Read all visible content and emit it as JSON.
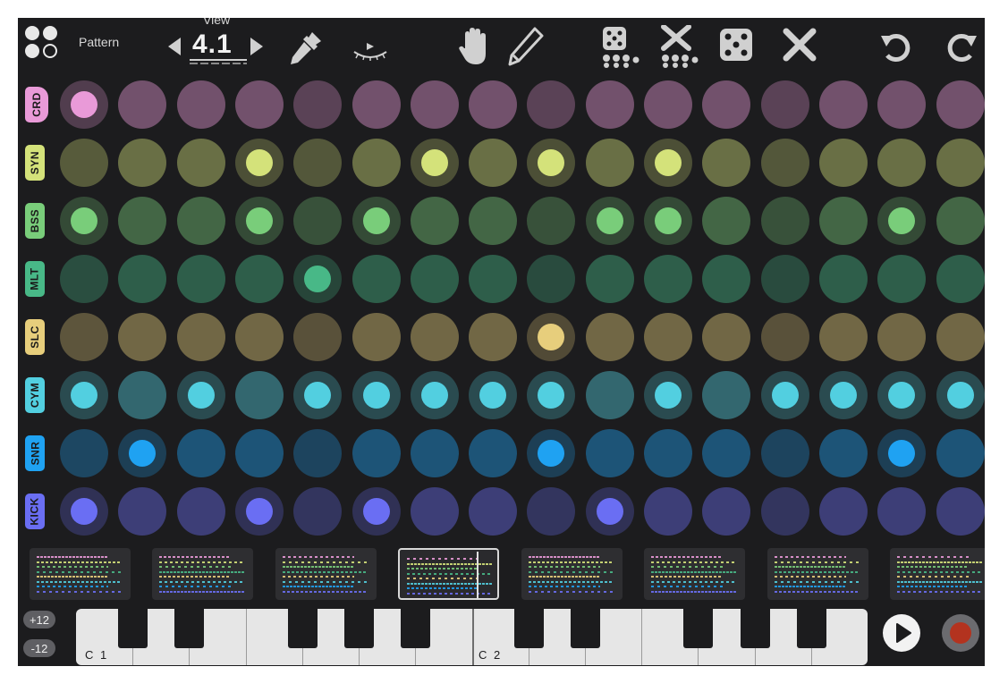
{
  "toolbar": {
    "pattern_label": "Pattern",
    "view_label": "View",
    "view_value": "4.1",
    "octave_up_label": "+12",
    "octave_down_label": "-12",
    "icons": [
      "pattern-logo-icon",
      "arrow-left-icon",
      "arrow-right-icon",
      "eyedropper-icon",
      "hidden-eye-icon",
      "hand-icon",
      "pencil-icon",
      "randomize-notes-icon",
      "clear-notes-icon",
      "randomize-all-icon",
      "clear-all-icon",
      "undo-icon",
      "redo-icon"
    ]
  },
  "tracks": [
    {
      "label": "CRD",
      "color": "#e99ad8",
      "active": [
        0
      ]
    },
    {
      "label": "SYN",
      "color": "#d4e27a",
      "active": [
        3,
        6,
        8,
        10
      ]
    },
    {
      "label": "BSS",
      "color": "#79cd7a",
      "active": [
        0,
        3,
        5,
        9,
        10,
        14
      ]
    },
    {
      "label": "MLT",
      "color": "#48b887",
      "active": [
        4
      ]
    },
    {
      "label": "SLC",
      "color": "#e7ce7c",
      "active": [
        8
      ]
    },
    {
      "label": "CYM",
      "color": "#52cfe0",
      "active": [
        0,
        2,
        4,
        5,
        6,
        7,
        8,
        10,
        12,
        13,
        14,
        15
      ]
    },
    {
      "label": "SNR",
      "color": "#1fa2f2",
      "active": [
        1,
        8,
        14
      ]
    },
    {
      "label": "KICK",
      "color": "#6a6ef3",
      "active": [
        0,
        3,
        5,
        9
      ]
    }
  ],
  "patterns": {
    "count": 8,
    "selected_index": 3
  },
  "keyboard": {
    "octave_labels": [
      "C 1",
      "C 2"
    ]
  },
  "transport": {
    "play": "play-icon",
    "record": "record-icon"
  },
  "colors": {
    "background": "#1c1c1e",
    "record": "#b3331f"
  }
}
